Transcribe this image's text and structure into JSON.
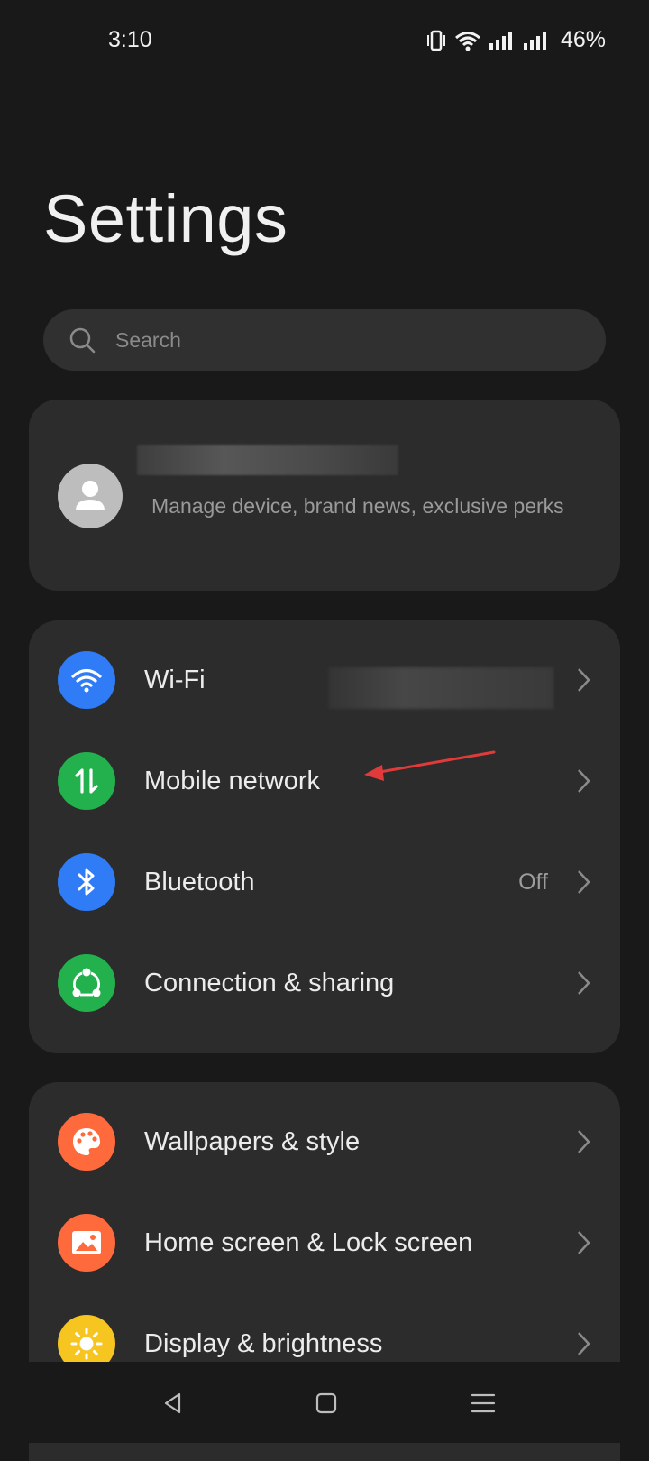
{
  "status_bar": {
    "time": "3:10",
    "battery_percent": "46%",
    "icons": [
      "vibrate-icon",
      "wifi-icon",
      "signal-icon",
      "signal-icon"
    ]
  },
  "page": {
    "title": "Settings"
  },
  "search": {
    "placeholder": "Search"
  },
  "account": {
    "subtitle": "Manage device, brand news, exclusive perks",
    "avatar_icon": "person-icon"
  },
  "network_items": [
    {
      "label": "Wi-Fi",
      "value": "",
      "icon": "wifi-icon",
      "color": "#2f7cf6"
    },
    {
      "label": "Mobile network",
      "value": "",
      "icon": "mobile-data-icon",
      "color": "#22b14c"
    },
    {
      "label": "Bluetooth",
      "value": "Off",
      "icon": "bluetooth-icon",
      "color": "#2f7cf6"
    },
    {
      "label": "Connection & sharing",
      "value": "",
      "icon": "share-icon",
      "color": "#22b14c"
    }
  ],
  "personal_items": [
    {
      "label": "Wallpapers & style",
      "icon": "palette-icon",
      "color": "#ff6a3d"
    },
    {
      "label": "Home screen & Lock screen",
      "icon": "image-icon",
      "color": "#ff6a3d"
    },
    {
      "label": "Display & brightness",
      "icon": "sun-icon",
      "color": "#f7c520"
    }
  ],
  "nav": {
    "icons": [
      "back-icon",
      "home-icon",
      "menu-icon"
    ]
  }
}
